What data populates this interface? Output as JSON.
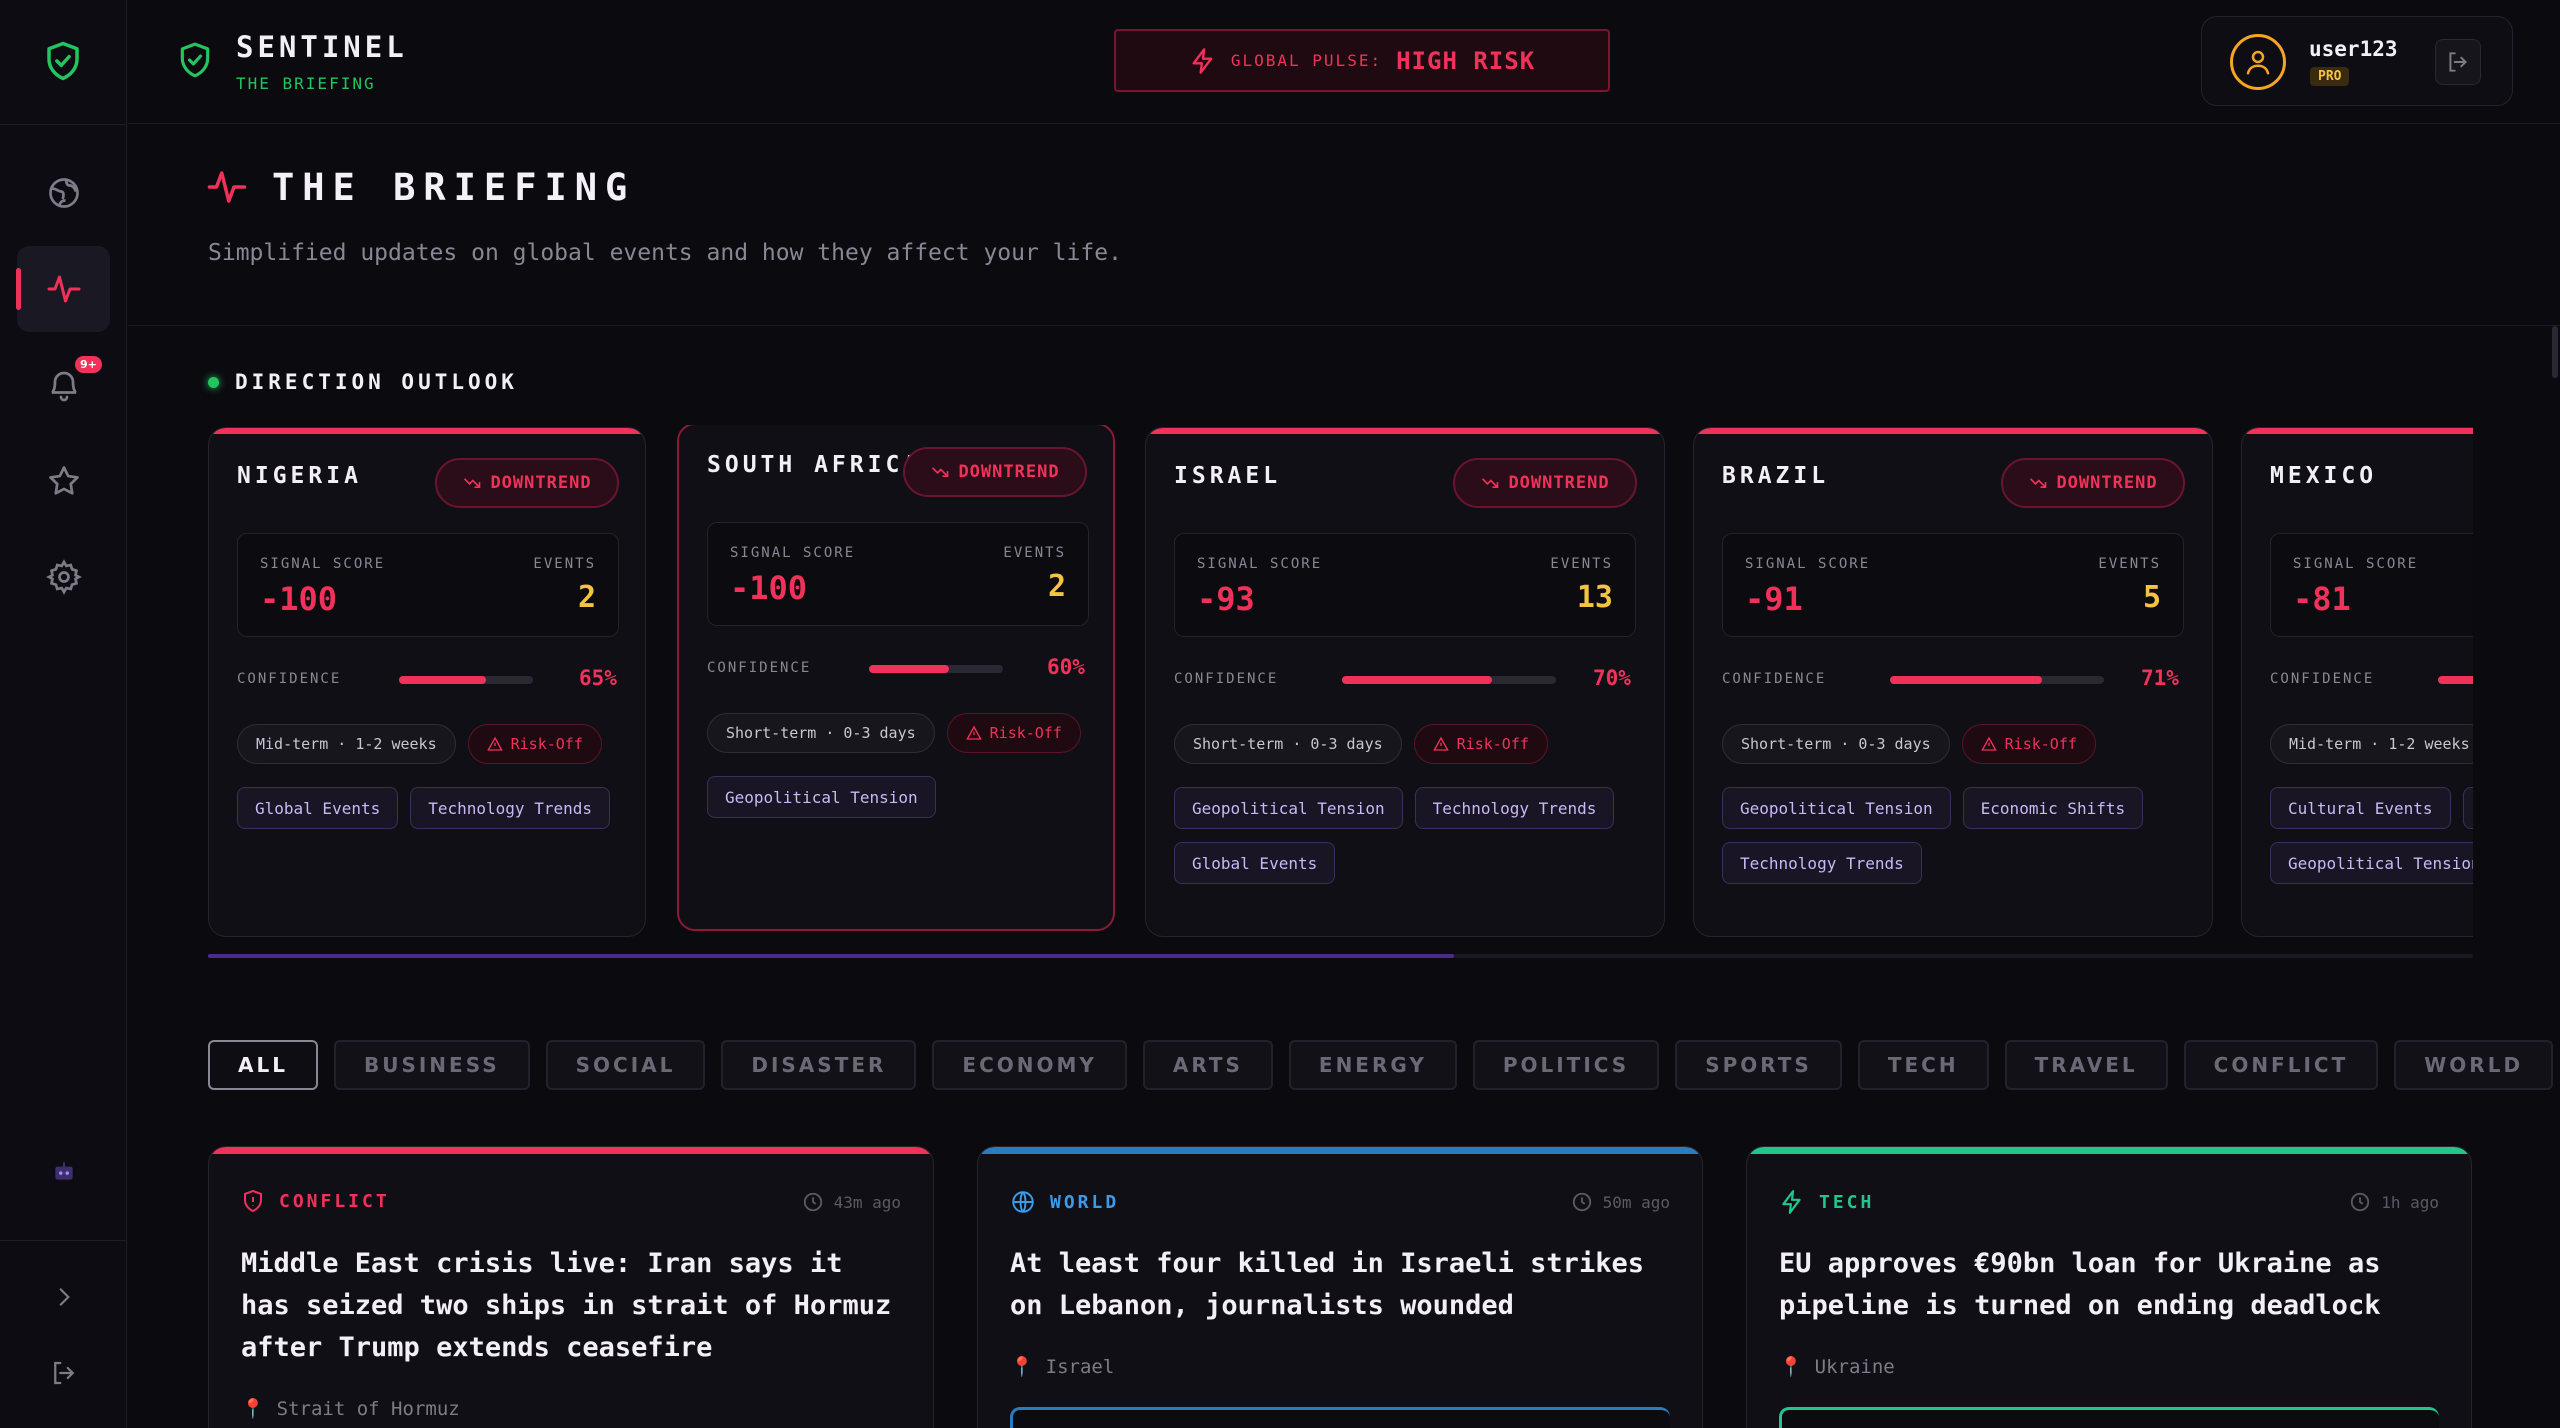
{
  "brand": {
    "name": "SENTINEL",
    "subtitle": "THE BRIEFING"
  },
  "pulse": {
    "label": "GLOBAL PULSE:",
    "value": "HIGH RISK"
  },
  "user": {
    "name": "user123",
    "plan": "PRO"
  },
  "sidebar": {
    "notification_count": "9+"
  },
  "page": {
    "title": "THE BRIEFING",
    "subtitle": "Simplified updates on global events and how they affect your life."
  },
  "outlook": {
    "title": "DIRECTION OUTLOOK",
    "labels": {
      "signal": "SIGNAL SCORE",
      "events": "EVENTS",
      "confidence": "CONFIDENCE"
    },
    "scroll_position": 0.55,
    "countries": [
      {
        "name": "NIGERIA",
        "trend": "DOWNTREND",
        "score": "-100",
        "events": "2",
        "confidence": "65%",
        "confidence_value": 0.65,
        "term": "Mid-term · 1-2 weeks",
        "risk": "Risk-Off",
        "tags": [
          "Global Events",
          "Technology Trends"
        ]
      },
      {
        "name": "SOUTH AFRICA",
        "trend": "DOWNTREND",
        "score": "-100",
        "events": "2",
        "confidence": "60%",
        "confidence_value": 0.6,
        "term": "Short-term · 0-3 days",
        "risk": "Risk-Off",
        "tags": [
          "Geopolitical Tension"
        ]
      },
      {
        "name": "ISRAEL",
        "trend": "DOWNTREND",
        "score": "-93",
        "events": "13",
        "confidence": "70%",
        "confidence_value": 0.7,
        "term": "Short-term · 0-3 days",
        "risk": "Risk-Off",
        "tags": [
          "Geopolitical Tension",
          "Technology Trends",
          "Global Events"
        ]
      },
      {
        "name": "BRAZIL",
        "trend": "DOWNTREND",
        "score": "-91",
        "events": "5",
        "confidence": "71%",
        "confidence_value": 0.71,
        "term": "Short-term · 0-3 days",
        "risk": "Risk-Off",
        "tags": [
          "Geopolitical Tension",
          "Economic Shifts",
          "Technology Trends"
        ]
      },
      {
        "name": "MEXICO",
        "score": "-81",
        "term": "Mid-term · 1-2 weeks",
        "tags": [
          "Cultural Events",
          "Geopolitical Tension"
        ]
      }
    ]
  },
  "filters": [
    "ALL",
    "BUSINESS",
    "SOCIAL",
    "DISASTER",
    "ECONOMY",
    "ARTS",
    "ENERGY",
    "POLITICS",
    "SPORTS",
    "TECH",
    "TRAVEL",
    "CONFLICT",
    "WORLD"
  ],
  "news": [
    {
      "category": "CONFLICT",
      "time": "43m ago",
      "title": "Middle East crisis live: Iran says it has seized two ships in strait of Hormuz after Trump extends ceasefire",
      "location": "Strait of Hormuz",
      "color": "#f0325a"
    },
    {
      "category": "WORLD",
      "time": "50m ago",
      "title": "At least four killed in Israeli strikes on Lebanon, journalists wounded",
      "location": "Israel",
      "color": "#3b9be8"
    },
    {
      "category": "TECH",
      "time": "1h ago",
      "title": "EU approves €90bn loan for Ukraine as pipeline is turned on ending deadlock",
      "location": "Ukraine",
      "color": "#22c58b"
    }
  ]
}
